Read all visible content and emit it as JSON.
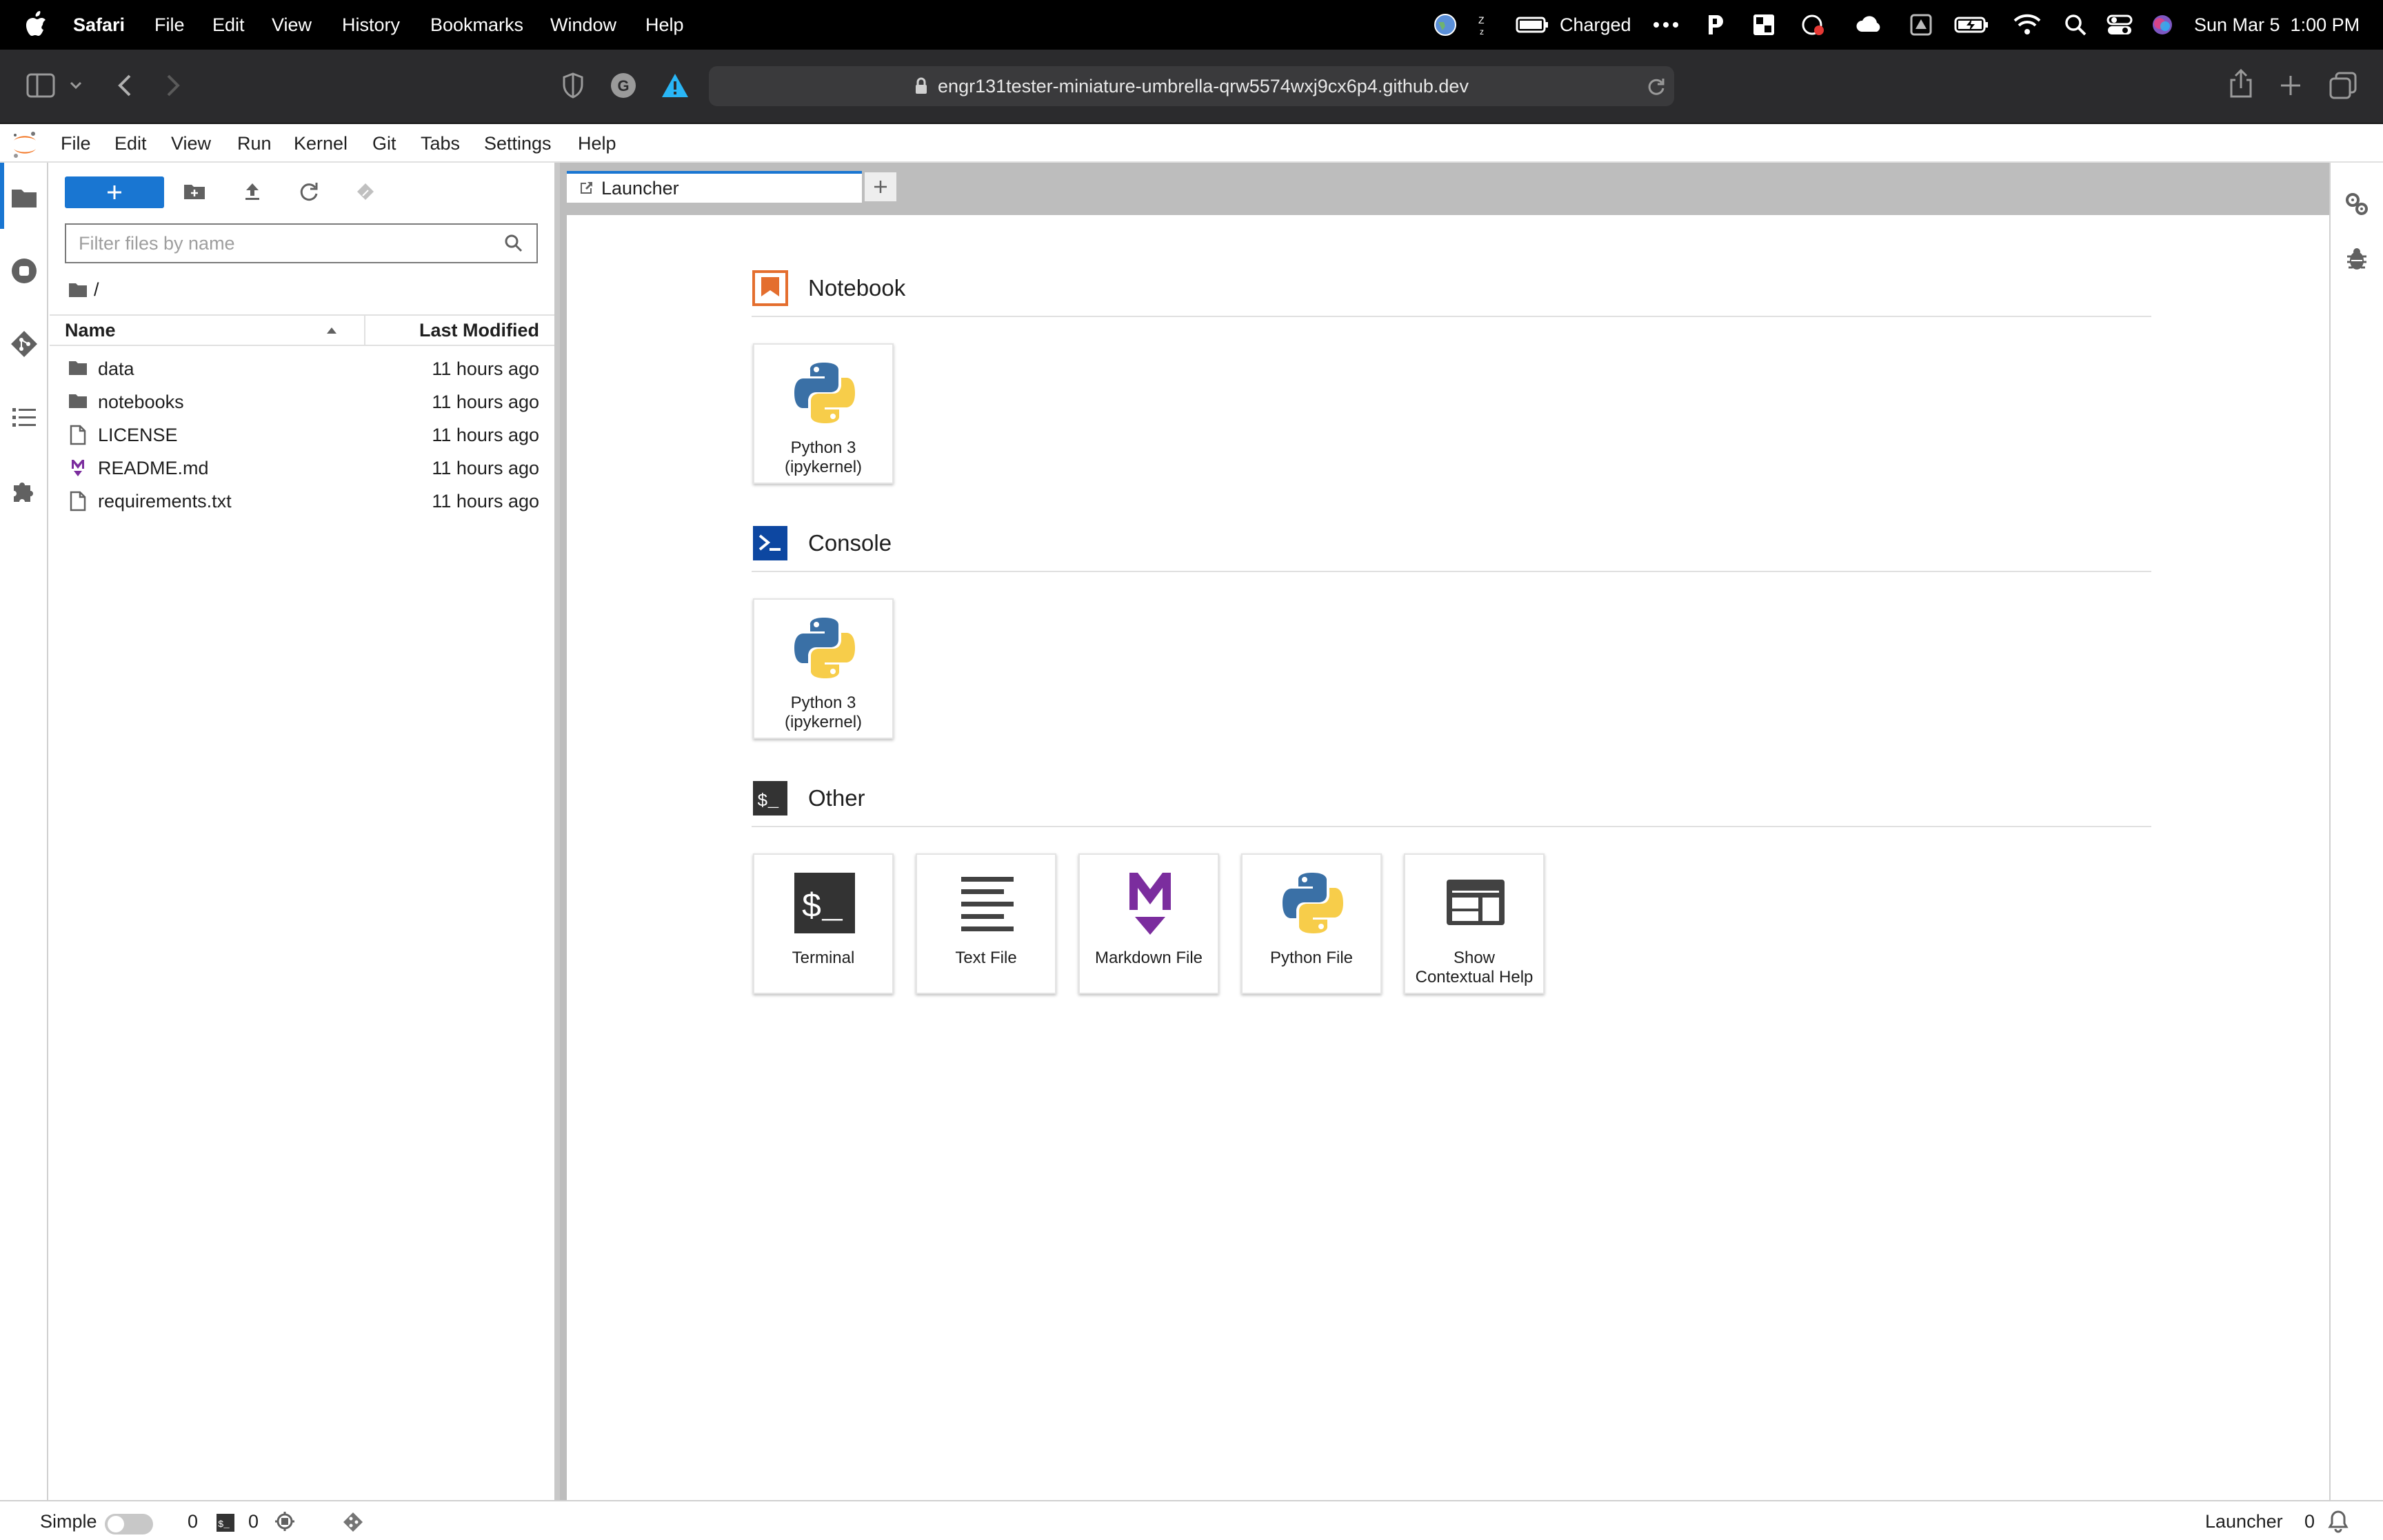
{
  "macos": {
    "app_name": "Safari",
    "menus": [
      "File",
      "Edit",
      "View",
      "History",
      "Bookmarks",
      "Window",
      "Help"
    ],
    "battery_status": "Charged",
    "datetime": "Sun Mar 5  1:00 PM"
  },
  "safari": {
    "url": "engr131tester-miniature-umbrella-qrw5574wxj9cx6p4.github.dev"
  },
  "jupyter": {
    "menus": [
      "File",
      "Edit",
      "View",
      "Run",
      "Kernel",
      "Git",
      "Tabs",
      "Settings",
      "Help"
    ],
    "filebrowser": {
      "new_label": "+",
      "filter_placeholder": "Filter files by name",
      "breadcrumb": "/",
      "col_name": "Name",
      "col_modified": "Last Modified",
      "files": [
        {
          "name": "data",
          "type": "folder",
          "modified": "11 hours ago"
        },
        {
          "name": "notebooks",
          "type": "folder",
          "modified": "11 hours ago"
        },
        {
          "name": "LICENSE",
          "type": "file",
          "modified": "11 hours ago"
        },
        {
          "name": "README.md",
          "type": "markdown",
          "modified": "11 hours ago"
        },
        {
          "name": "requirements.txt",
          "type": "file",
          "modified": "11 hours ago"
        }
      ]
    },
    "tabs": [
      {
        "label": "Launcher"
      }
    ],
    "add_tab_label": "+",
    "launcher": {
      "sections": [
        {
          "title": "Notebook",
          "cards": [
            {
              "label_line1": "Python 3",
              "label_line2": "(ipykernel)"
            }
          ]
        },
        {
          "title": "Console",
          "cards": [
            {
              "label_line1": "Python 3",
              "label_line2": "(ipykernel)"
            }
          ]
        },
        {
          "title": "Other",
          "cards": [
            {
              "label_line1": "Terminal",
              "label_line2": ""
            },
            {
              "label_line1": "Text File",
              "label_line2": ""
            },
            {
              "label_line1": "Markdown File",
              "label_line2": ""
            },
            {
              "label_line1": "Python File",
              "label_line2": ""
            },
            {
              "label_line1": "Show",
              "label_line2": "Contextual Help"
            }
          ]
        }
      ]
    },
    "statusbar": {
      "mode_label": "Simple",
      "terminals_count": "0",
      "kernels_count": "0",
      "active_label": "Launcher",
      "notifications_count": "0"
    }
  },
  "colors": {
    "accent": "#1976d2",
    "notebook_icon": "#e46e2e",
    "console_icon": "#0d47a1",
    "markdown_icon": "#7b2d9e",
    "python_blue": "#3a70a6",
    "python_yellow": "#f7cd4a"
  }
}
